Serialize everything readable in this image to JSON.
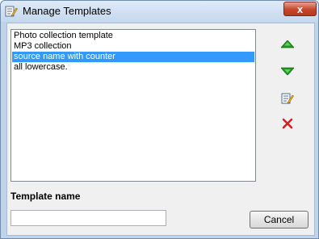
{
  "window": {
    "title": "Manage Templates",
    "close_label": "x"
  },
  "templates": {
    "items": [
      {
        "label": "Photo collection template",
        "selected": false
      },
      {
        "label": "MP3 collection",
        "selected": false
      },
      {
        "label": "source name with counter",
        "selected": true
      },
      {
        "label": "all lowercase.",
        "selected": false
      }
    ]
  },
  "toolbar": {
    "move_up_icon": "arrow-up-icon",
    "move_down_icon": "arrow-down-icon",
    "edit_icon": "edit-icon",
    "delete_icon": "delete-icon"
  },
  "form": {
    "template_name_label": "Template name",
    "template_name_value": ""
  },
  "buttons": {
    "cancel_label": "Cancel"
  },
  "colors": {
    "selection": "#3399ff",
    "arrow_green": "#1e9a1e",
    "delete_red": "#d42020"
  }
}
